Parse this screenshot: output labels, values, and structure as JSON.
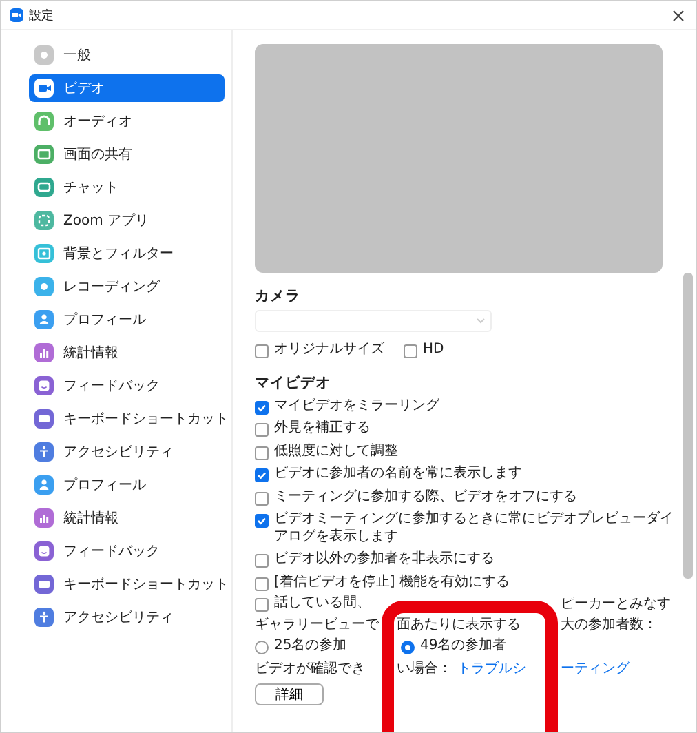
{
  "window": {
    "title": "設定"
  },
  "sidebar": {
    "items": [
      {
        "label": "一般",
        "kind": "gear",
        "color": "#c8c8c8",
        "selected": false
      },
      {
        "label": "ビデオ",
        "kind": "camera",
        "color": "#ffffff",
        "selected": true
      },
      {
        "label": "オーディオ",
        "kind": "headphones",
        "color": "#5fbf6a",
        "selected": false
      },
      {
        "label": "画面の共有",
        "kind": "screen",
        "color": "#4caf65",
        "selected": false
      },
      {
        "label": "チャット",
        "kind": "chat",
        "color": "#2fa88f",
        "selected": false
      },
      {
        "label": "Zoom アプリ",
        "kind": "apps",
        "color": "#4db8a0",
        "selected": false
      },
      {
        "label": "背景とフィルター",
        "kind": "frame",
        "color": "#35c0d8",
        "selected": false
      },
      {
        "label": "レコーディング",
        "kind": "record",
        "color": "#3bb2ea",
        "selected": false
      },
      {
        "label": "プロフィール",
        "kind": "person",
        "color": "#3b9ff0",
        "selected": false
      },
      {
        "label": "統計情報",
        "kind": "chart",
        "color": "#b06cd6",
        "selected": false
      },
      {
        "label": "フィードバック",
        "kind": "smiley",
        "color": "#8a62d4",
        "selected": false
      },
      {
        "label": "キーボードショートカット",
        "kind": "keyboard",
        "color": "#7367d6",
        "selected": false
      },
      {
        "label": "アクセシビリティ",
        "kind": "access",
        "color": "#4f7de0",
        "selected": false
      },
      {
        "label": "プロフィール",
        "kind": "person",
        "color": "#3b9ff0",
        "selected": false
      },
      {
        "label": "統計情報",
        "kind": "chart",
        "color": "#b06cd6",
        "selected": false
      },
      {
        "label": "フィードバック",
        "kind": "smiley",
        "color": "#8a62d4",
        "selected": false
      },
      {
        "label": "キーボードショートカット",
        "kind": "keyboard",
        "color": "#7367d6",
        "selected": false
      },
      {
        "label": "アクセシビリティ",
        "kind": "access",
        "color": "#4f7de0",
        "selected": false
      }
    ]
  },
  "camera": {
    "heading": "カメラ",
    "options": [
      {
        "label": "オリジナルサイズ",
        "checked": false
      },
      {
        "label": "HD",
        "checked": false
      }
    ]
  },
  "my_video": {
    "heading": "マイビデオ",
    "options": [
      {
        "label": "マイビデオをミラーリング",
        "checked": true
      },
      {
        "label": "外見を補正する",
        "checked": false
      },
      {
        "label": "低照度に対して調整",
        "checked": false
      },
      {
        "label": "ビデオに参加者の名前を常に表示します",
        "checked": true
      },
      {
        "label": "ミーティングに参加する際、ビデオをオフにする",
        "checked": false
      },
      {
        "label": "ビデオミーティングに参加するときに常にビデオプレビューダイアログを表示します",
        "checked": true
      },
      {
        "label": "ビデオ以外の参加者を非表示にする",
        "checked": false
      },
      {
        "label": "[着信ビデオを停止] 機能を有効にする",
        "checked": false
      }
    ]
  },
  "covered_option": {
    "parts": [
      "話している間、",
      "ピーカーとみなす"
    ],
    "checked": false
  },
  "gallery": {
    "label_parts": [
      "ギャラリービューで",
      "面あたりに表示する",
      "大の参加者数："
    ],
    "options": [
      {
        "label": "25名の参加",
        "selected": false
      },
      {
        "label": "49名の参加者",
        "selected": true
      }
    ]
  },
  "troubleshoot": {
    "label_parts": [
      "ビデオが確認でき",
      "い場合："
    ],
    "link_parts": [
      "トラブルシ",
      "ーティング"
    ]
  },
  "buttons": [
    "詳細"
  ],
  "annotation": {
    "kind": "frame"
  }
}
